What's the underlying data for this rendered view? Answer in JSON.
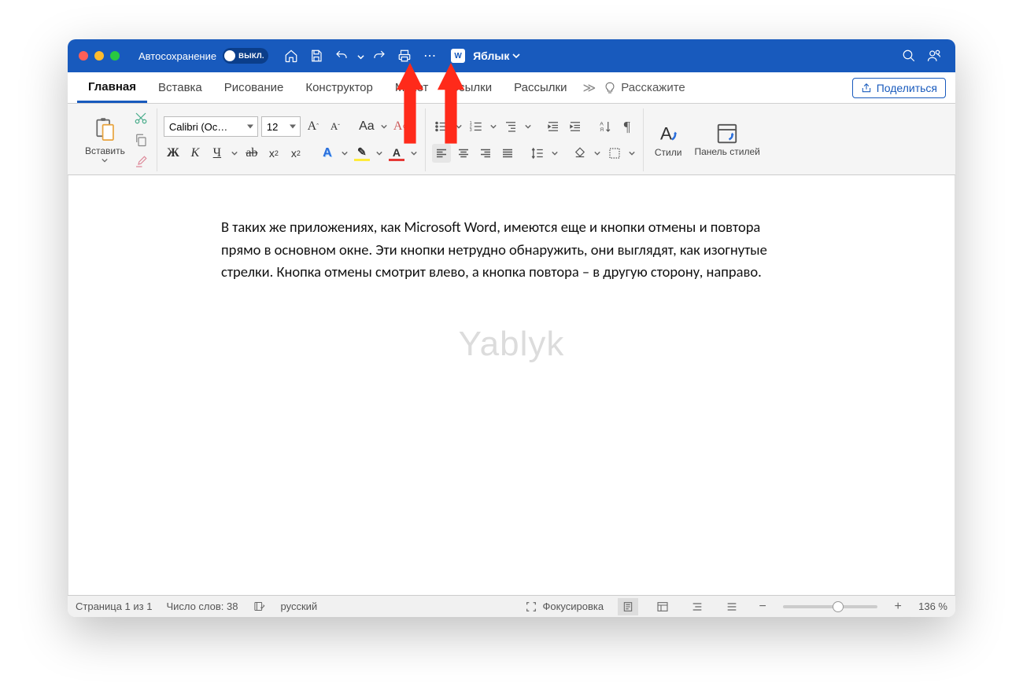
{
  "titlebar": {
    "autosave_label": "Автосохранение",
    "autosave_state": "ВЫКЛ.",
    "doc_name": "Яблык"
  },
  "tabs": {
    "items": [
      "Главная",
      "Вставка",
      "Рисование",
      "Конструктор",
      "Макет",
      "Ссылки",
      "Рассылки"
    ],
    "active_index": 0,
    "tell_me": "Расскажите",
    "share": "Поделиться"
  },
  "ribbon": {
    "paste": "Вставить",
    "font_name": "Calibri (Ос…",
    "font_size": "12",
    "bold": "Ж",
    "italic": "К",
    "underline": "Ч",
    "strike": "ab",
    "subscript": "x",
    "superscript": "x",
    "case_label": "Aa",
    "styles": "Стили",
    "styles_panel": "Панель стилей"
  },
  "document": {
    "body": "В таких же приложениях, как Microsoft Word, имеются еще и кнопки отмены и повтора прямо в основном окне. Эти кнопки нетрудно обнаружить, они выглядят, как изогнутые стрелки. Кнопка отмены смотрит влево, а кнопка повтора – в другую сторону, направо.",
    "watermark": "Yablyk"
  },
  "statusbar": {
    "page": "Страница 1 из 1",
    "words": "Число слов: 38",
    "language": "русский",
    "focus": "Фокусировка",
    "zoom": "136 %"
  }
}
